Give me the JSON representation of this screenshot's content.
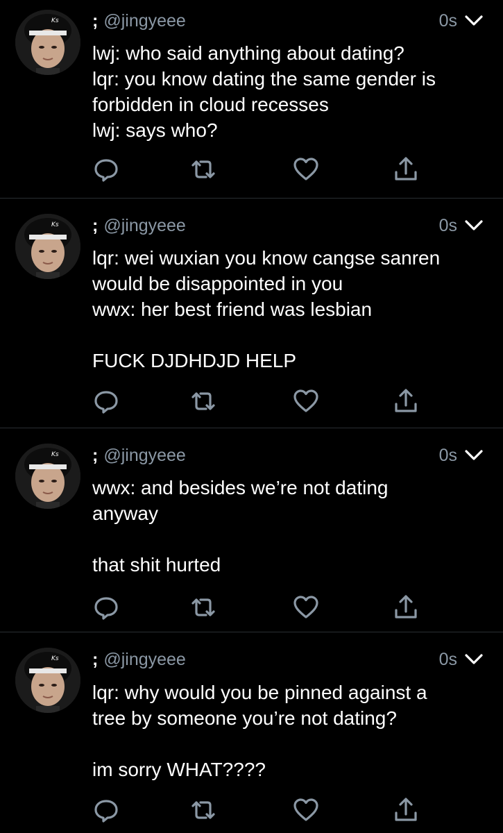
{
  "colors": {
    "background": "#000000",
    "text": "#ffffff",
    "secondary_text": "#8b98a5",
    "divider": "#2a2f33"
  },
  "tweets": [
    {
      "prefix": ";",
      "handle": "@jingyeee",
      "time": "0s",
      "lines": [
        "lwj: who said anything about dating?",
        "lqr: you know dating the same gender is",
        "forbidden in cloud recesses",
        "lwj: says who?"
      ]
    },
    {
      "prefix": ";",
      "handle": "@jingyeee",
      "time": "0s",
      "lines": [
        "lqr: wei wuxian you know cangse sanren",
        "would be disappointed in you",
        "wwx: her best friend was lesbian",
        "",
        "FUCK DJDHDJD HELP"
      ]
    },
    {
      "prefix": ";",
      "handle": "@jingyeee",
      "time": "0s",
      "lines": [
        "wwx: and besides we’re not dating",
        "anyway",
        "",
        "that shit hurted"
      ]
    },
    {
      "prefix": ";",
      "handle": "@jingyeee",
      "time": "0s",
      "lines": [
        "lqr: why would you be pinned against a",
        "tree by someone you’re not dating?",
        "",
        "im sorry WHAT????"
      ]
    }
  ],
  "icons": {
    "more": "chevron-down-icon",
    "reply": "reply-icon",
    "retweet": "retweet-icon",
    "like": "heart-icon",
    "share": "share-icon"
  }
}
